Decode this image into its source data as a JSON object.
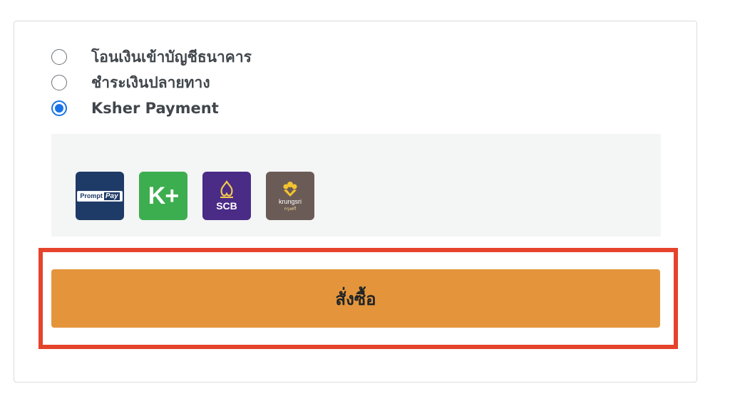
{
  "payment_options": [
    {
      "label": "โอนเงินเข้าบัญชีธนาคาร",
      "selected": false
    },
    {
      "label": "ชำระเงินปลายทาง",
      "selected": false
    },
    {
      "label": "Ksher Payment",
      "selected": true
    }
  ],
  "ksher_methods": [
    {
      "name": "PromptPay",
      "icon": "promptpay-icon",
      "logo_text_a": "Prompt",
      "logo_text_b": "Pay",
      "color": "#1e3a66"
    },
    {
      "name": "K+",
      "icon": "kplus-icon",
      "logo_text": "K+",
      "color": "#3cae4f"
    },
    {
      "name": "SCB",
      "icon": "scb-icon",
      "logo_text": "SCB",
      "color": "#4a2b86"
    },
    {
      "name": "krungsri",
      "icon": "krungsri-icon",
      "logo_text": "krungsri",
      "logo_subtext": "กรุงศรี",
      "color": "#6b5b56"
    }
  ],
  "order_button": {
    "label": "สั่งซื้อ",
    "color": "#e4953c"
  },
  "highlight_color": "#e5432c",
  "accent_color": "#1a73e8"
}
